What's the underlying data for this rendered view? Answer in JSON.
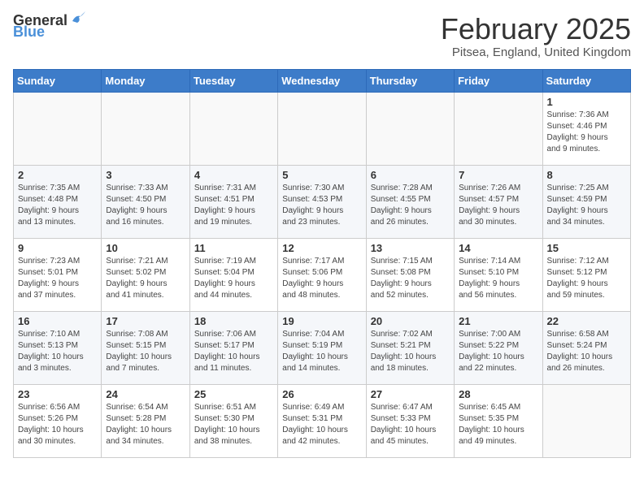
{
  "logo": {
    "general": "General",
    "blue": "Blue"
  },
  "title": {
    "month_year": "February 2025",
    "location": "Pitsea, England, United Kingdom"
  },
  "weekdays": [
    "Sunday",
    "Monday",
    "Tuesday",
    "Wednesday",
    "Thursday",
    "Friday",
    "Saturday"
  ],
  "weeks": [
    [
      {
        "day": "",
        "info": ""
      },
      {
        "day": "",
        "info": ""
      },
      {
        "day": "",
        "info": ""
      },
      {
        "day": "",
        "info": ""
      },
      {
        "day": "",
        "info": ""
      },
      {
        "day": "",
        "info": ""
      },
      {
        "day": "1",
        "info": "Sunrise: 7:36 AM\nSunset: 4:46 PM\nDaylight: 9 hours\nand 9 minutes."
      }
    ],
    [
      {
        "day": "2",
        "info": "Sunrise: 7:35 AM\nSunset: 4:48 PM\nDaylight: 9 hours\nand 13 minutes."
      },
      {
        "day": "3",
        "info": "Sunrise: 7:33 AM\nSunset: 4:50 PM\nDaylight: 9 hours\nand 16 minutes."
      },
      {
        "day": "4",
        "info": "Sunrise: 7:31 AM\nSunset: 4:51 PM\nDaylight: 9 hours\nand 19 minutes."
      },
      {
        "day": "5",
        "info": "Sunrise: 7:30 AM\nSunset: 4:53 PM\nDaylight: 9 hours\nand 23 minutes."
      },
      {
        "day": "6",
        "info": "Sunrise: 7:28 AM\nSunset: 4:55 PM\nDaylight: 9 hours\nand 26 minutes."
      },
      {
        "day": "7",
        "info": "Sunrise: 7:26 AM\nSunset: 4:57 PM\nDaylight: 9 hours\nand 30 minutes."
      },
      {
        "day": "8",
        "info": "Sunrise: 7:25 AM\nSunset: 4:59 PM\nDaylight: 9 hours\nand 34 minutes."
      }
    ],
    [
      {
        "day": "9",
        "info": "Sunrise: 7:23 AM\nSunset: 5:01 PM\nDaylight: 9 hours\nand 37 minutes."
      },
      {
        "day": "10",
        "info": "Sunrise: 7:21 AM\nSunset: 5:02 PM\nDaylight: 9 hours\nand 41 minutes."
      },
      {
        "day": "11",
        "info": "Sunrise: 7:19 AM\nSunset: 5:04 PM\nDaylight: 9 hours\nand 44 minutes."
      },
      {
        "day": "12",
        "info": "Sunrise: 7:17 AM\nSunset: 5:06 PM\nDaylight: 9 hours\nand 48 minutes."
      },
      {
        "day": "13",
        "info": "Sunrise: 7:15 AM\nSunset: 5:08 PM\nDaylight: 9 hours\nand 52 minutes."
      },
      {
        "day": "14",
        "info": "Sunrise: 7:14 AM\nSunset: 5:10 PM\nDaylight: 9 hours\nand 56 minutes."
      },
      {
        "day": "15",
        "info": "Sunrise: 7:12 AM\nSunset: 5:12 PM\nDaylight: 9 hours\nand 59 minutes."
      }
    ],
    [
      {
        "day": "16",
        "info": "Sunrise: 7:10 AM\nSunset: 5:13 PM\nDaylight: 10 hours\nand 3 minutes."
      },
      {
        "day": "17",
        "info": "Sunrise: 7:08 AM\nSunset: 5:15 PM\nDaylight: 10 hours\nand 7 minutes."
      },
      {
        "day": "18",
        "info": "Sunrise: 7:06 AM\nSunset: 5:17 PM\nDaylight: 10 hours\nand 11 minutes."
      },
      {
        "day": "19",
        "info": "Sunrise: 7:04 AM\nSunset: 5:19 PM\nDaylight: 10 hours\nand 14 minutes."
      },
      {
        "day": "20",
        "info": "Sunrise: 7:02 AM\nSunset: 5:21 PM\nDaylight: 10 hours\nand 18 minutes."
      },
      {
        "day": "21",
        "info": "Sunrise: 7:00 AM\nSunset: 5:22 PM\nDaylight: 10 hours\nand 22 minutes."
      },
      {
        "day": "22",
        "info": "Sunrise: 6:58 AM\nSunset: 5:24 PM\nDaylight: 10 hours\nand 26 minutes."
      }
    ],
    [
      {
        "day": "23",
        "info": "Sunrise: 6:56 AM\nSunset: 5:26 PM\nDaylight: 10 hours\nand 30 minutes."
      },
      {
        "day": "24",
        "info": "Sunrise: 6:54 AM\nSunset: 5:28 PM\nDaylight: 10 hours\nand 34 minutes."
      },
      {
        "day": "25",
        "info": "Sunrise: 6:51 AM\nSunset: 5:30 PM\nDaylight: 10 hours\nand 38 minutes."
      },
      {
        "day": "26",
        "info": "Sunrise: 6:49 AM\nSunset: 5:31 PM\nDaylight: 10 hours\nand 42 minutes."
      },
      {
        "day": "27",
        "info": "Sunrise: 6:47 AM\nSunset: 5:33 PM\nDaylight: 10 hours\nand 45 minutes."
      },
      {
        "day": "28",
        "info": "Sunrise: 6:45 AM\nSunset: 5:35 PM\nDaylight: 10 hours\nand 49 minutes."
      },
      {
        "day": "",
        "info": ""
      }
    ]
  ]
}
